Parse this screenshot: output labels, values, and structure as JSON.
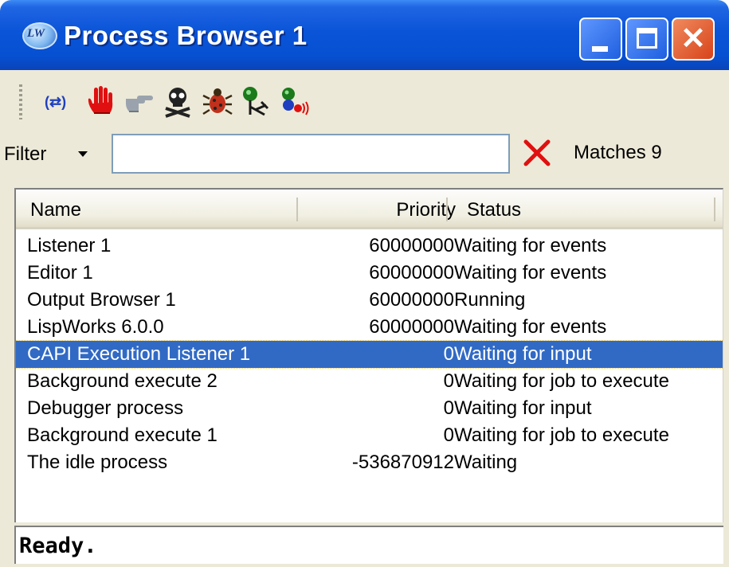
{
  "window": {
    "title": "Process Browser 1",
    "app_icon_text": "LW"
  },
  "toolbar": {
    "tools": [
      {
        "icon": "brackets-icon",
        "label": "(⇄)"
      },
      {
        "icon": "stop-hand-icon"
      },
      {
        "icon": "pointing-hand-icon"
      },
      {
        "icon": "skull-icon"
      },
      {
        "icon": "bug-icon"
      },
      {
        "icon": "process-run-icon"
      },
      {
        "icon": "process-signal-icon"
      }
    ]
  },
  "filter": {
    "label": "Filter",
    "value": "",
    "matches_label": "Matches 9"
  },
  "list": {
    "columns": {
      "name": "Name",
      "priority": "Priority",
      "status": "Status"
    },
    "rows": [
      {
        "name": "Listener 1",
        "priority": "60000000",
        "status": "Waiting for events"
      },
      {
        "name": "Editor 1",
        "priority": "60000000",
        "status": "Waiting for events"
      },
      {
        "name": "Output Browser 1",
        "priority": "60000000",
        "status": "Running"
      },
      {
        "name": "LispWorks 6.0.0",
        "priority": "60000000",
        "status": "Waiting for events"
      },
      {
        "name": "CAPI Execution Listener 1",
        "priority": "0",
        "status": "Waiting for input",
        "selected": true
      },
      {
        "name": "Background execute 2",
        "priority": "0",
        "status": "Waiting for job to execute"
      },
      {
        "name": "Debugger process",
        "priority": "0",
        "status": "Waiting for input"
      },
      {
        "name": "Background execute 1",
        "priority": "0",
        "status": "Waiting for job to execute"
      },
      {
        "name": "The idle process",
        "priority": "-536870912",
        "status": "Waiting"
      }
    ]
  },
  "status_bar": {
    "text": "Ready."
  },
  "colors": {
    "titlebar": "#0a54d8",
    "selection": "#316ac5",
    "window_bg": "#ece9d8"
  }
}
